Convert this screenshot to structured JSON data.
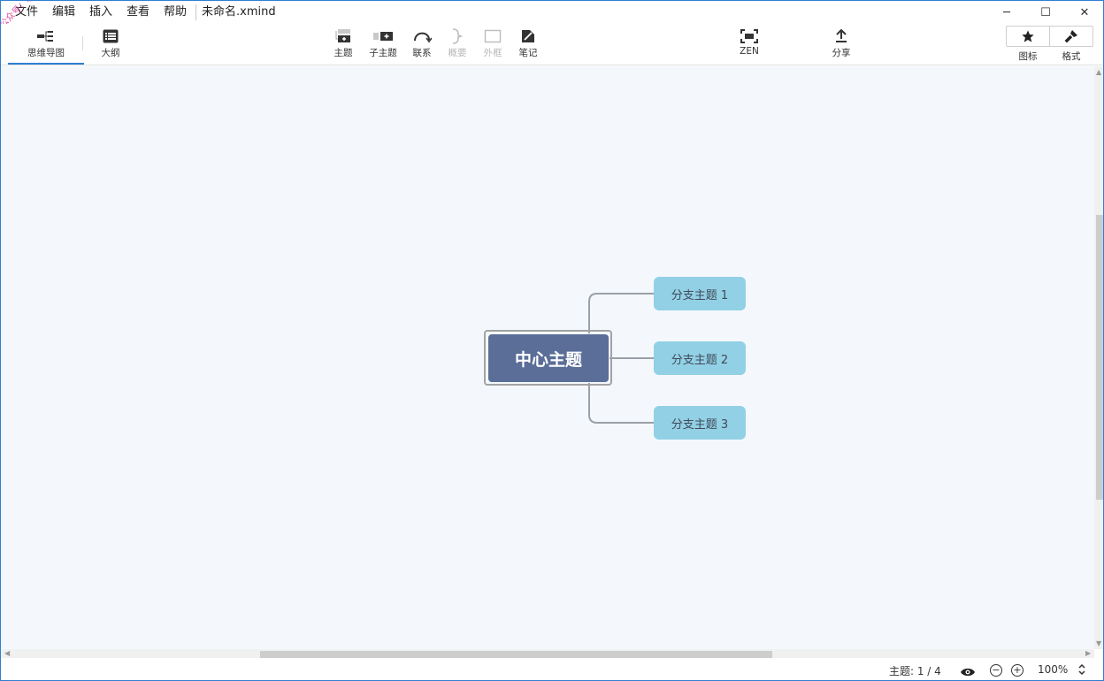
{
  "menu": {
    "items": [
      "文件",
      "编辑",
      "插入",
      "查看",
      "帮助"
    ],
    "document_title": "未命名.xmind"
  },
  "watermark": "公众号：软件小屋",
  "window_controls": {
    "minimize": "─",
    "maximize": "☐",
    "close": "✕"
  },
  "toolbar": {
    "view_tabs": [
      {
        "label": "思维导图",
        "icon": "mindmap-icon",
        "active": true
      },
      {
        "label": "大纲",
        "icon": "outline-icon",
        "active": false
      }
    ],
    "insert_tools": [
      {
        "label": "主题",
        "icon": "topic-icon",
        "enabled": true
      },
      {
        "label": "子主题",
        "icon": "subtopic-icon",
        "enabled": true
      },
      {
        "label": "联系",
        "icon": "relationship-icon",
        "enabled": true
      },
      {
        "label": "概要",
        "icon": "summary-icon",
        "enabled": false
      },
      {
        "label": "外框",
        "icon": "boundary-icon",
        "enabled": false
      },
      {
        "label": "笔记",
        "icon": "note-icon",
        "enabled": true
      }
    ],
    "zen": {
      "label": "ZEN",
      "icon": "zen-icon"
    },
    "share": {
      "label": "分享",
      "icon": "share-icon"
    },
    "panels": [
      {
        "label": "图标",
        "icon": "star-icon"
      },
      {
        "label": "格式",
        "icon": "brush-icon"
      }
    ]
  },
  "mindmap": {
    "central_topic": "中心主题",
    "branches": [
      "分支主题 1",
      "分支主题 2",
      "分支主题 3"
    ],
    "colors": {
      "central": "#5a6e98",
      "branch": "#92d0e6",
      "canvas": "#f4f8fc"
    }
  },
  "statusbar": {
    "topic_count": "主题: 1 / 4",
    "zoom": "100%"
  }
}
